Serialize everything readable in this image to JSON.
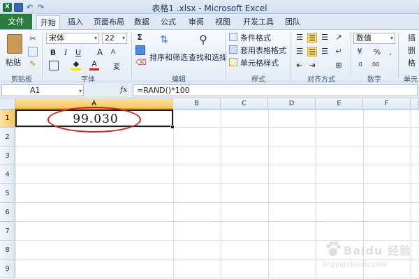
{
  "window": {
    "title": "表格1 .xlsx - Microsoft Excel",
    "app_icon_letter": "X"
  },
  "tabs": [
    {
      "label": "文件"
    },
    {
      "label": "开始"
    },
    {
      "label": "插入"
    },
    {
      "label": "页面布局"
    },
    {
      "label": "数据"
    },
    {
      "label": "公式"
    },
    {
      "label": "审阅"
    },
    {
      "label": "视图"
    },
    {
      "label": "开发工具"
    },
    {
      "label": "团队"
    }
  ],
  "ribbon": {
    "clipboard": {
      "paste": "粘贴",
      "label": "剪贴板"
    },
    "font": {
      "family": "宋体",
      "size": "22",
      "bold": "B",
      "italic": "I",
      "underline": "U",
      "grow": "A",
      "shrink": "A",
      "label": "字体"
    },
    "editing": {
      "sigma": "Σ",
      "sort_filter": "排序和筛选",
      "find_select": "查找和选择",
      "label": "编辑"
    },
    "styles": {
      "conditional": "条件格式",
      "table_format": "套用表格格式",
      "cell_styles": "单元格样式",
      "label": "样式"
    },
    "alignment": {
      "label": "对齐方式"
    },
    "number": {
      "format": "数值",
      "label": "数字",
      "percent": "%",
      "comma": ","
    },
    "cells": {
      "insert": "插",
      "delete": "删",
      "format": "格",
      "label": "单元"
    }
  },
  "formula_bar": {
    "name_box": "A1",
    "fx": "fx",
    "formula": "=RAND()*100"
  },
  "grid": {
    "columns": [
      "A",
      "B",
      "C",
      "D",
      "E",
      "F"
    ],
    "rows": [
      "1",
      "2",
      "3",
      "4",
      "5",
      "6",
      "7",
      "8",
      "9"
    ],
    "cell_a1": "99.030"
  },
  "watermark": {
    "text": "Baidu 经验",
    "url": "jingyan.baidu.com"
  }
}
